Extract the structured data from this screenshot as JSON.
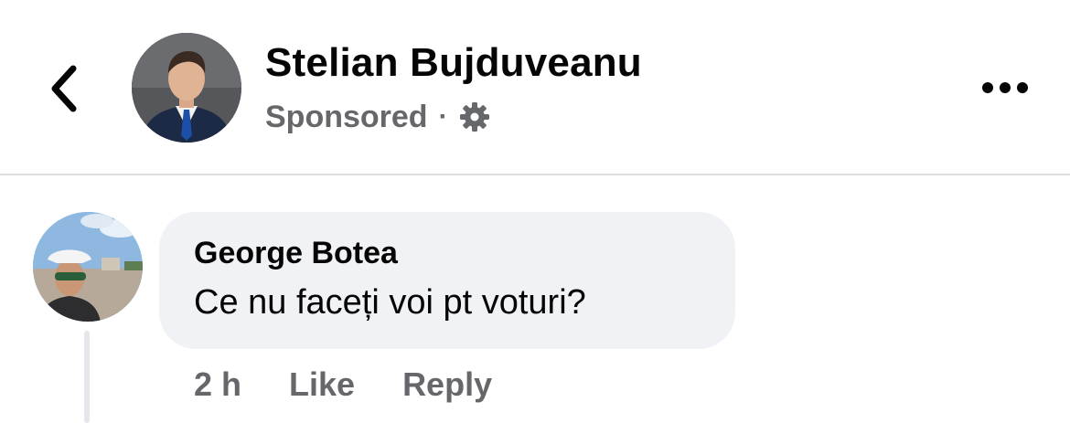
{
  "header": {
    "back_icon": "chevron-left-icon",
    "page_name": "Stelian Bujduveanu",
    "sponsored_label": "Sponsored",
    "separator": "·",
    "audience_icon": "gear-icon",
    "more_icon": "more-horizontal-icon"
  },
  "comment": {
    "author": "George Botea",
    "text": "Ce nu faceți voi pt voturi?",
    "time": "2 h",
    "like_label": "Like",
    "reply_label": "Reply"
  },
  "colors": {
    "primary_text": "#050505",
    "secondary_text": "#65676b",
    "bubble_bg": "#f0f2f5",
    "divider": "#dcdde0"
  }
}
